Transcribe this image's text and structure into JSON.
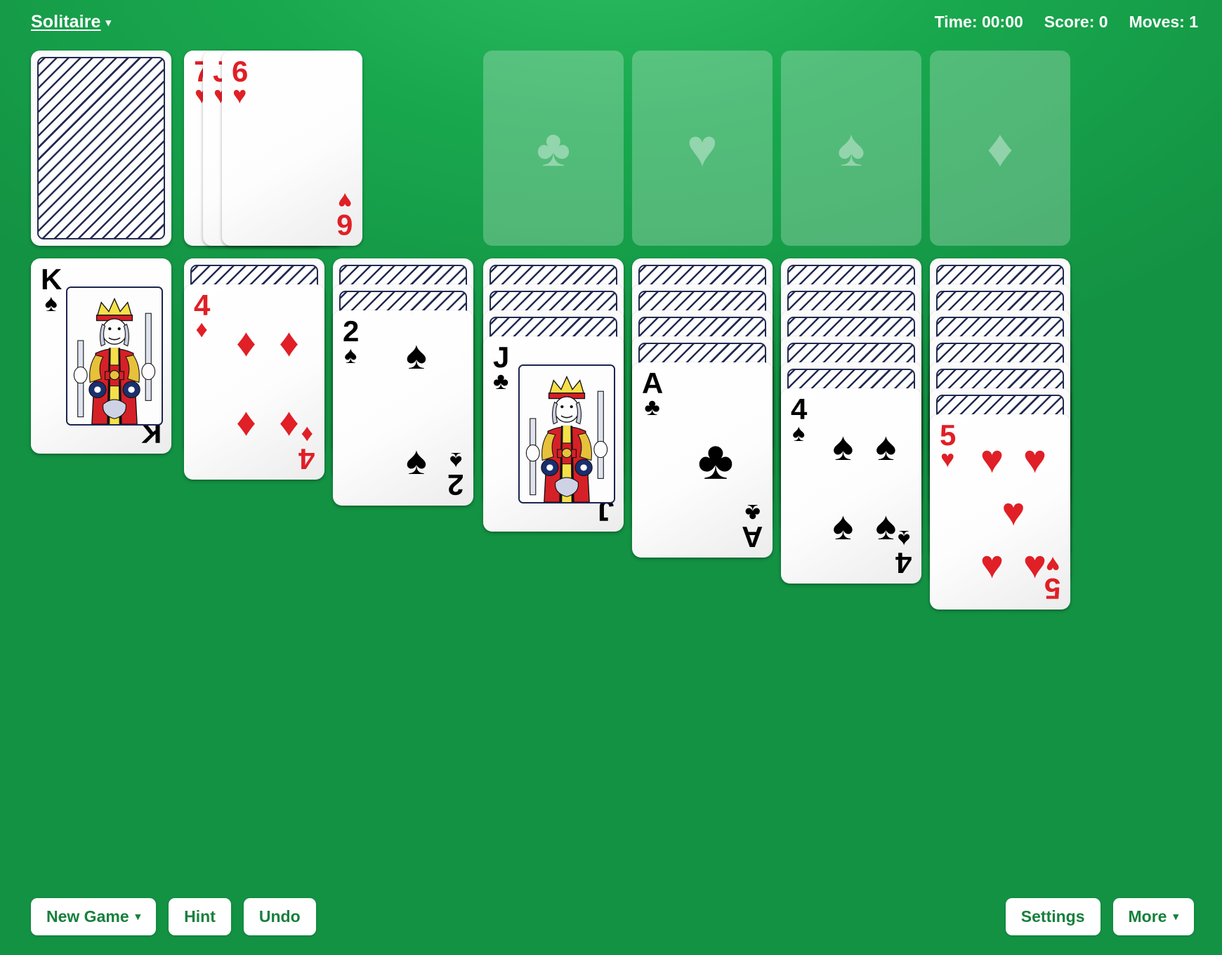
{
  "header": {
    "app_menu_label": "Solitaire",
    "caret": "▾",
    "time": "Time: 00:00",
    "score": "Score: 0",
    "moves": "Moves: 1"
  },
  "suits": {
    "spade": "♠",
    "heart": "♥",
    "club": "♣",
    "diamond": "♦"
  },
  "colors": {
    "felt": "#19a84e",
    "red_suit": "#e01f26",
    "black_suit": "#000000",
    "button_text": "#17803c",
    "card_back_line": "#222b52"
  },
  "stock": {
    "face_down": true
  },
  "waste": {
    "cards": [
      {
        "rank": "7",
        "suit": "♥",
        "color": "red"
      },
      {
        "rank": "J",
        "suit": "♥",
        "color": "red"
      },
      {
        "rank": "6",
        "suit": "♥",
        "color": "red"
      }
    ]
  },
  "foundations": [
    {
      "suit": "♣",
      "name": "clubs",
      "empty": true
    },
    {
      "suit": "♥",
      "name": "hearts",
      "empty": true
    },
    {
      "suit": "♠",
      "name": "spades",
      "empty": true
    },
    {
      "suit": "♦",
      "name": "diamonds",
      "empty": true
    }
  ],
  "tableau": [
    {
      "face_down": 0,
      "top_card": {
        "rank": "K",
        "suit": "♠",
        "color": "black",
        "court": true
      }
    },
    {
      "face_down": 1,
      "top_card": {
        "rank": "4",
        "suit": "♦",
        "color": "red",
        "pips": 4
      }
    },
    {
      "face_down": 2,
      "top_card": {
        "rank": "2",
        "suit": "♠",
        "color": "black",
        "pips": 2
      }
    },
    {
      "face_down": 3,
      "top_card": {
        "rank": "J",
        "suit": "♣",
        "color": "black",
        "court": true
      }
    },
    {
      "face_down": 4,
      "top_card": {
        "rank": "A",
        "suit": "♣",
        "color": "black",
        "pips": 1
      }
    },
    {
      "face_down": 5,
      "top_card": {
        "rank": "4",
        "suit": "♠",
        "color": "black",
        "pips": 4
      }
    },
    {
      "face_down": 6,
      "top_card": {
        "rank": "5",
        "suit": "♥",
        "color": "red",
        "pips": 5
      }
    }
  ],
  "toolbar": {
    "new_game": "New Game",
    "hint": "Hint",
    "undo": "Undo",
    "settings": "Settings",
    "more": "More",
    "caret": "▾"
  }
}
